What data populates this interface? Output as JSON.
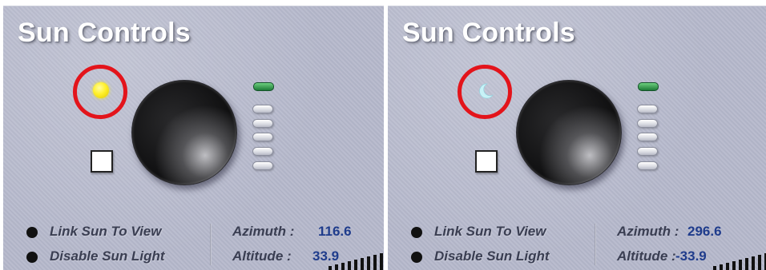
{
  "panels": [
    {
      "title": "Sun Controls",
      "mode": "sun",
      "icon": "sun-icon",
      "options": {
        "link_sun_to_view": "Link Sun To View",
        "disable_sun_light": "Disable Sun Light"
      },
      "azimuth_label": "Azimuth :",
      "azimuth_value": "116.6",
      "altitude_label": "Altitude :",
      "altitude_value": "33.9"
    },
    {
      "title": "Sun Controls",
      "mode": "moon",
      "icon": "moon-icon",
      "options": {
        "link_sun_to_view": "Link Sun To View",
        "disable_sun_light": "Disable Sun Light"
      },
      "azimuth_label": "Azimuth :",
      "azimuth_value": "296.6",
      "altitude_label": "Altitude :",
      "altitude_value": "-33.9"
    }
  ],
  "colors": {
    "panel_bg": "#b6b9cc",
    "highlight_ring": "#e3141b",
    "sun_yellow": "#fff02a",
    "moon_cyan": "#c8f2f7",
    "value_blue": "#1f3c8c",
    "led_green": "#2fa24a"
  }
}
